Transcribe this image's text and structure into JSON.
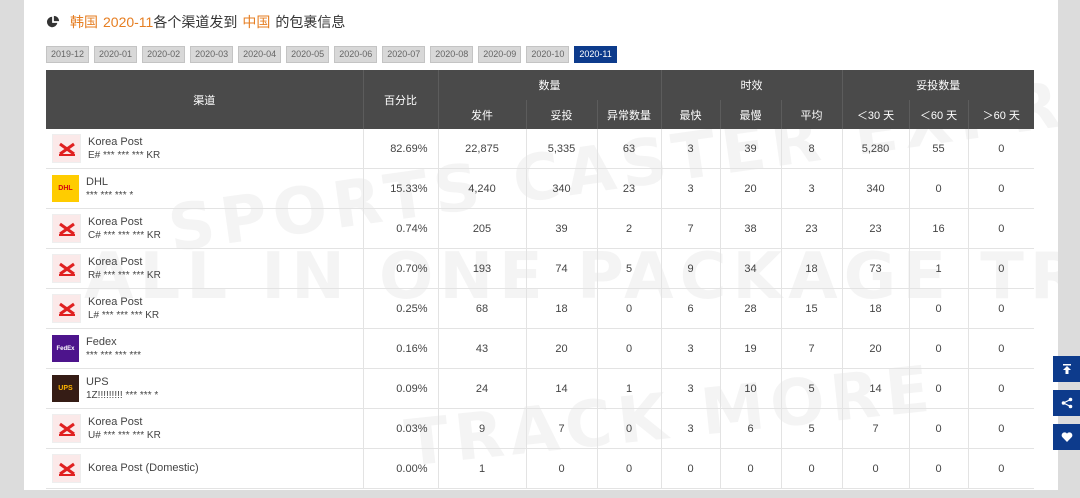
{
  "title": {
    "country": "韩国",
    "month": "2020-11",
    "mid": "各个渠道发到",
    "dest": "中国",
    "suffix": "的包裹信息"
  },
  "months": [
    "2019-12",
    "2020-01",
    "2020-02",
    "2020-03",
    "2020-04",
    "2020-05",
    "2020-06",
    "2020-07",
    "2020-08",
    "2020-09",
    "2020-10",
    "2020-11"
  ],
  "active_month": "2020-11",
  "headers": {
    "channel": "渠道",
    "percent": "百分比",
    "group_qty": "数量",
    "group_time": "时效",
    "group_delivered": "妥投数量",
    "sent": "发件",
    "delivered": "妥投",
    "abnormal": "异常数量",
    "fastest": "最快",
    "slowest": "最慢",
    "average": "平均",
    "lt30": "＜30 天",
    "lt60": "＜60 天",
    "gt60": "＞60 天"
  },
  "rows": [
    {
      "name": "Korea Post",
      "tracking": "E# *** *** *** KR",
      "logo": "kp",
      "percent": "82.69%",
      "sent": "22,875",
      "delivered": "5,335",
      "abnormal": "63",
      "fastest": "3",
      "slowest": "39",
      "average": "8",
      "lt30": "5,280",
      "lt60": "55",
      "gt60": "0"
    },
    {
      "name": "DHL",
      "tracking": "*** *** *** *",
      "logo": "dhl",
      "percent": "15.33%",
      "sent": "4,240",
      "delivered": "340",
      "abnormal": "23",
      "fastest": "3",
      "slowest": "20",
      "average": "3",
      "lt30": "340",
      "lt60": "0",
      "gt60": "0"
    },
    {
      "name": "Korea Post",
      "tracking": "C# *** *** *** KR",
      "logo": "kp",
      "percent": "0.74%",
      "sent": "205",
      "delivered": "39",
      "abnormal": "2",
      "fastest": "7",
      "slowest": "38",
      "average": "23",
      "lt30": "23",
      "lt60": "16",
      "gt60": "0"
    },
    {
      "name": "Korea Post",
      "tracking": "R# *** *** *** KR",
      "logo": "kp",
      "percent": "0.70%",
      "sent": "193",
      "delivered": "74",
      "abnormal": "5",
      "fastest": "9",
      "slowest": "34",
      "average": "18",
      "lt30": "73",
      "lt60": "1",
      "gt60": "0"
    },
    {
      "name": "Korea Post",
      "tracking": "L# *** *** *** KR",
      "logo": "kp",
      "percent": "0.25%",
      "sent": "68",
      "delivered": "18",
      "abnormal": "0",
      "fastest": "6",
      "slowest": "28",
      "average": "15",
      "lt30": "18",
      "lt60": "0",
      "gt60": "0"
    },
    {
      "name": "Fedex",
      "tracking": "*** *** *** ***",
      "logo": "fedex",
      "percent": "0.16%",
      "sent": "43",
      "delivered": "20",
      "abnormal": "0",
      "fastest": "3",
      "slowest": "19",
      "average": "7",
      "lt30": "20",
      "lt60": "0",
      "gt60": "0"
    },
    {
      "name": "UPS",
      "tracking": "1Z!!!!!!!!! *** *** *",
      "logo": "ups",
      "percent": "0.09%",
      "sent": "24",
      "delivered": "14",
      "abnormal": "1",
      "fastest": "3",
      "slowest": "10",
      "average": "5",
      "lt30": "14",
      "lt60": "0",
      "gt60": "0"
    },
    {
      "name": "Korea Post",
      "tracking": "U# *** *** *** KR",
      "logo": "kp",
      "percent": "0.03%",
      "sent": "9",
      "delivered": "7",
      "abnormal": "0",
      "fastest": "3",
      "slowest": "6",
      "average": "5",
      "lt30": "7",
      "lt60": "0",
      "gt60": "0"
    },
    {
      "name": "Korea Post (Domestic)",
      "tracking": "",
      "logo": "kp",
      "percent": "0.00%",
      "sent": "1",
      "delivered": "0",
      "abnormal": "0",
      "fastest": "0",
      "slowest": "0",
      "average": "0",
      "lt30": "0",
      "lt60": "0",
      "gt60": "0"
    }
  ],
  "logos": {
    "dhl": "DHL",
    "fedex": "FedEx",
    "ups": "UPS",
    "kp": ""
  },
  "side_buttons": [
    "back-to-top-icon",
    "share-icon",
    "heart-icon"
  ],
  "colors": {
    "accent": "#e67e22",
    "active": "#0d3b8c",
    "header_bg": "#4a4a4a"
  }
}
